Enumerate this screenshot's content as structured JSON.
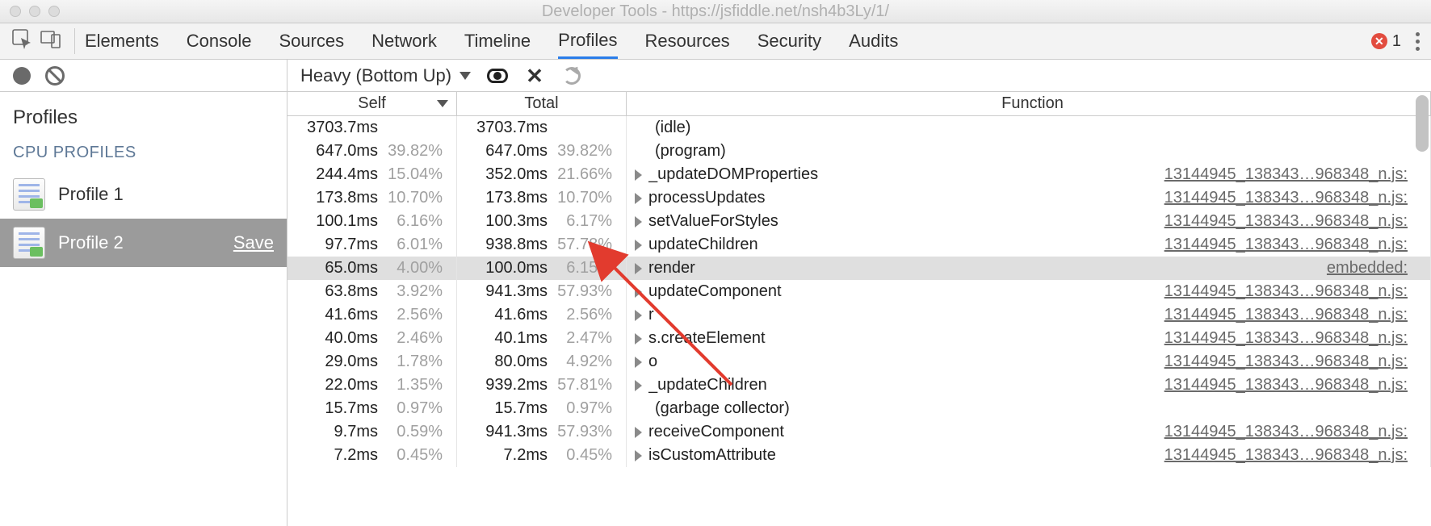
{
  "window": {
    "title": "Developer Tools - https://jsfiddle.net/nsh4b3Ly/1/"
  },
  "toolbar": {
    "tabs": [
      "Elements",
      "Console",
      "Sources",
      "Network",
      "Timeline",
      "Profiles",
      "Resources",
      "Security",
      "Audits"
    ],
    "active_tab_index": 5,
    "error_count": "1"
  },
  "sidebar": {
    "title": "Profiles",
    "section": "CPU PROFILES",
    "items": [
      {
        "label": "Profile 1",
        "selected": false
      },
      {
        "label": "Profile 2",
        "selected": true,
        "save_label": "Save"
      }
    ]
  },
  "main_toolbar": {
    "view_mode": "Heavy (Bottom Up)"
  },
  "table": {
    "headers": {
      "self": "Self",
      "total": "Total",
      "function": "Function"
    },
    "source_link": "13144945_138343…968348_n.js:",
    "render_link": "embedded:",
    "rows": [
      {
        "self_ms": "3703.7ms",
        "self_pct": "",
        "total_ms": "3703.7ms",
        "total_pct": "",
        "fn": "(idle)",
        "expandable": false,
        "link": ""
      },
      {
        "self_ms": "647.0ms",
        "self_pct": "39.82%",
        "total_ms": "647.0ms",
        "total_pct": "39.82%",
        "fn": "(program)",
        "expandable": false,
        "link": ""
      },
      {
        "self_ms": "244.4ms",
        "self_pct": "15.04%",
        "total_ms": "352.0ms",
        "total_pct": "21.66%",
        "fn": "_updateDOMProperties",
        "expandable": true,
        "link": "src"
      },
      {
        "self_ms": "173.8ms",
        "self_pct": "10.70%",
        "total_ms": "173.8ms",
        "total_pct": "10.70%",
        "fn": "processUpdates",
        "expandable": true,
        "link": "src"
      },
      {
        "self_ms": "100.1ms",
        "self_pct": "6.16%",
        "total_ms": "100.3ms",
        "total_pct": "6.17%",
        "fn": "setValueForStyles",
        "expandable": true,
        "link": "src"
      },
      {
        "self_ms": "97.7ms",
        "self_pct": "6.01%",
        "total_ms": "938.8ms",
        "total_pct": "57.78%",
        "fn": "updateChildren",
        "expandable": true,
        "link": "src"
      },
      {
        "self_ms": "65.0ms",
        "self_pct": "4.00%",
        "total_ms": "100.0ms",
        "total_pct": "6.15%",
        "fn": "render",
        "expandable": true,
        "link": "render",
        "selected": true
      },
      {
        "self_ms": "63.8ms",
        "self_pct": "3.92%",
        "total_ms": "941.3ms",
        "total_pct": "57.93%",
        "fn": "updateComponent",
        "expandable": true,
        "link": "src"
      },
      {
        "self_ms": "41.6ms",
        "self_pct": "2.56%",
        "total_ms": "41.6ms",
        "total_pct": "2.56%",
        "fn": "r",
        "expandable": true,
        "link": "src"
      },
      {
        "self_ms": "40.0ms",
        "self_pct": "2.46%",
        "total_ms": "40.1ms",
        "total_pct": "2.47%",
        "fn": "s.createElement",
        "expandable": true,
        "link": "src"
      },
      {
        "self_ms": "29.0ms",
        "self_pct": "1.78%",
        "total_ms": "80.0ms",
        "total_pct": "4.92%",
        "fn": "o",
        "expandable": true,
        "link": "src"
      },
      {
        "self_ms": "22.0ms",
        "self_pct": "1.35%",
        "total_ms": "939.2ms",
        "total_pct": "57.81%",
        "fn": "_updateChildren",
        "expandable": true,
        "link": "src"
      },
      {
        "self_ms": "15.7ms",
        "self_pct": "0.97%",
        "total_ms": "15.7ms",
        "total_pct": "0.97%",
        "fn": "(garbage collector)",
        "expandable": false,
        "link": ""
      },
      {
        "self_ms": "9.7ms",
        "self_pct": "0.59%",
        "total_ms": "941.3ms",
        "total_pct": "57.93%",
        "fn": "receiveComponent",
        "expandable": true,
        "link": "src"
      },
      {
        "self_ms": "7.2ms",
        "self_pct": "0.45%",
        "total_ms": "7.2ms",
        "total_pct": "0.45%",
        "fn": "isCustomAttribute",
        "expandable": true,
        "link": "src"
      }
    ]
  }
}
